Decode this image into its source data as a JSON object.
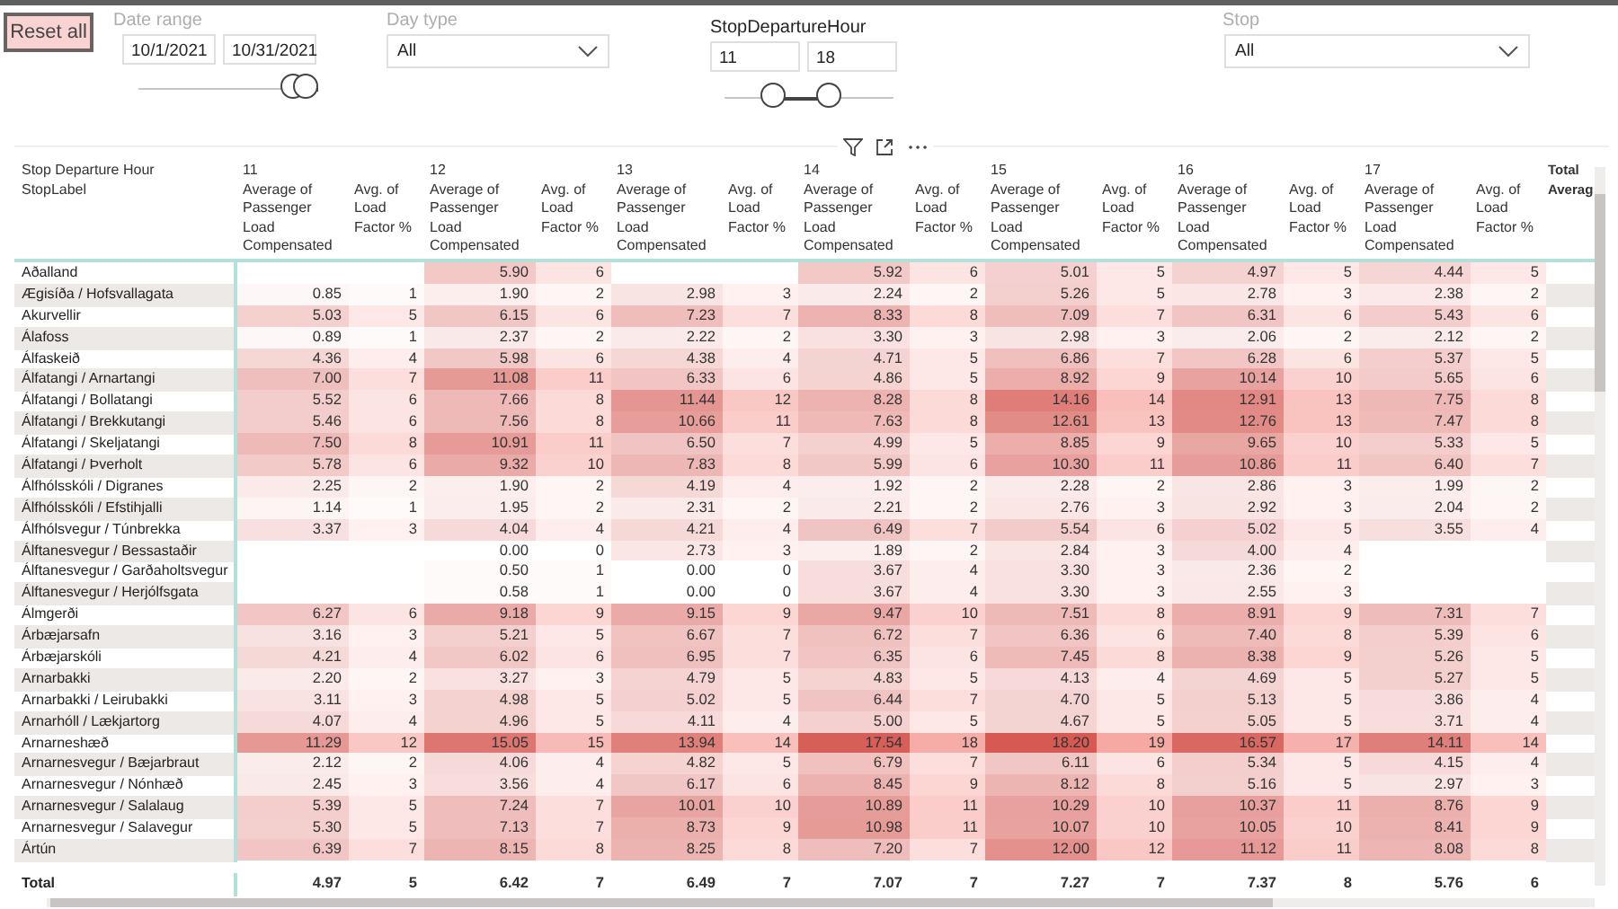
{
  "filters": {
    "reset_button": "Reset all",
    "date_range": {
      "label": "Date range",
      "start": "10/1/2021",
      "end": "10/31/2021",
      "slider": {
        "handles": [
          {
            "level": 0.93
          },
          {
            "level": 1.0
          }
        ]
      }
    },
    "day_type": {
      "label": "Day type",
      "value": "All"
    },
    "departure_hour": {
      "label": "StopDepartureHour",
      "start": "11",
      "end": "18",
      "slider": {
        "handles": [
          {
            "level": 0.29
          },
          {
            "level": 0.62
          }
        ]
      }
    },
    "stop": {
      "label": "Stop",
      "value": "All"
    }
  },
  "table": {
    "corner_top": "Stop Departure Hour",
    "corner_bottom": "StopLabel",
    "hours": [
      {
        "hour": "11",
        "measure_1": "Average of Passenger Load Compensated",
        "measure_2": "Avg. of Load Factor %"
      },
      {
        "hour": "12",
        "measure_1": "Average of Passenger Load Compensated",
        "measure_2": "Avg. of Load Factor %"
      },
      {
        "hour": "13",
        "measure_1": "Average of Passenger Load Compensated",
        "measure_2": "Avg. of Load Factor %"
      },
      {
        "hour": "14",
        "measure_1": "Average of Passenger Load Compensated",
        "measure_2": "Avg. of Load Factor %"
      },
      {
        "hour": "15",
        "measure_1": "Average of Passenger Load Compensated",
        "measure_2": "Avg. of Load Factor %"
      },
      {
        "hour": "16",
        "measure_1": "Average of Passenger Load Compensated",
        "measure_2": "Avg. of Load Factor %"
      },
      {
        "hour": "17",
        "measure_1": "Average of Passenger Load Compensated",
        "measure_2": "Avg. of Load Factor %"
      }
    ],
    "total_header": "Total Averag",
    "rows": [
      {
        "label": "Aðalland",
        "cells": [
          null,
          [
            "5.90",
            "6"
          ],
          null,
          [
            "5.92",
            "6"
          ],
          [
            "5.01",
            "5"
          ],
          [
            "4.97",
            "5"
          ],
          [
            "4.44",
            "5"
          ]
        ]
      },
      {
        "label": "Ægisíða / Hofsvallagata",
        "cells": [
          [
            "0.85",
            "1"
          ],
          [
            "1.90",
            "2"
          ],
          [
            "2.98",
            "3"
          ],
          [
            "2.24",
            "2"
          ],
          [
            "5.26",
            "5"
          ],
          [
            "2.78",
            "3"
          ],
          [
            "2.38",
            "2"
          ]
        ]
      },
      {
        "label": "Akurvellir",
        "cells": [
          [
            "5.03",
            "5"
          ],
          [
            "6.15",
            "6"
          ],
          [
            "7.23",
            "7"
          ],
          [
            "8.33",
            "8"
          ],
          [
            "7.09",
            "7"
          ],
          [
            "6.31",
            "6"
          ],
          [
            "5.43",
            "6"
          ]
        ]
      },
      {
        "label": "Álafoss",
        "cells": [
          [
            "0.89",
            "1"
          ],
          [
            "2.37",
            "2"
          ],
          [
            "2.22",
            "2"
          ],
          [
            "3.30",
            "3"
          ],
          [
            "2.98",
            "3"
          ],
          [
            "2.06",
            "2"
          ],
          [
            "2.12",
            "2"
          ]
        ]
      },
      {
        "label": "Álfaskeið",
        "cells": [
          [
            "4.36",
            "4"
          ],
          [
            "5.98",
            "6"
          ],
          [
            "4.38",
            "4"
          ],
          [
            "4.71",
            "5"
          ],
          [
            "6.86",
            "7"
          ],
          [
            "6.28",
            "6"
          ],
          [
            "5.37",
            "5"
          ]
        ]
      },
      {
        "label": "Álfatangi / Arnartangi",
        "cells": [
          [
            "7.00",
            "7"
          ],
          [
            "11.08",
            "11"
          ],
          [
            "6.33",
            "6"
          ],
          [
            "4.86",
            "5"
          ],
          [
            "8.92",
            "9"
          ],
          [
            "10.14",
            "10"
          ],
          [
            "5.65",
            "6"
          ]
        ]
      },
      {
        "label": "Álfatangi / Bollatangi",
        "cells": [
          [
            "5.52",
            "6"
          ],
          [
            "7.66",
            "8"
          ],
          [
            "11.44",
            "12"
          ],
          [
            "8.28",
            "8"
          ],
          [
            "14.16",
            "14"
          ],
          [
            "12.91",
            "13"
          ],
          [
            "7.75",
            "8"
          ]
        ]
      },
      {
        "label": "Álfatangi / Brekkutangi",
        "cells": [
          [
            "5.46",
            "6"
          ],
          [
            "7.56",
            "8"
          ],
          [
            "10.66",
            "11"
          ],
          [
            "7.63",
            "8"
          ],
          [
            "12.61",
            "13"
          ],
          [
            "12.76",
            "13"
          ],
          [
            "7.47",
            "8"
          ]
        ]
      },
      {
        "label": "Álfatangi / Skeljatangi",
        "cells": [
          [
            "7.50",
            "8"
          ],
          [
            "10.91",
            "11"
          ],
          [
            "6.50",
            "7"
          ],
          [
            "4.99",
            "5"
          ],
          [
            "8.85",
            "9"
          ],
          [
            "9.65",
            "10"
          ],
          [
            "5.33",
            "5"
          ]
        ]
      },
      {
        "label": "Álfatangi / Þverholt",
        "cells": [
          [
            "5.78",
            "6"
          ],
          [
            "9.32",
            "10"
          ],
          [
            "7.83",
            "8"
          ],
          [
            "5.99",
            "6"
          ],
          [
            "10.30",
            "11"
          ],
          [
            "10.86",
            "11"
          ],
          [
            "6.40",
            "7"
          ]
        ]
      },
      {
        "label": "Álfhólsskóli / Digranes",
        "cells": [
          [
            "2.25",
            "2"
          ],
          [
            "1.90",
            "2"
          ],
          [
            "4.19",
            "4"
          ],
          [
            "1.92",
            "2"
          ],
          [
            "2.28",
            "2"
          ],
          [
            "2.86",
            "3"
          ],
          [
            "1.99",
            "2"
          ]
        ]
      },
      {
        "label": "Álfhólsskóli / Efstihjalli",
        "cells": [
          [
            "1.14",
            "1"
          ],
          [
            "1.95",
            "2"
          ],
          [
            "2.31",
            "2"
          ],
          [
            "2.21",
            "2"
          ],
          [
            "2.76",
            "3"
          ],
          [
            "2.92",
            "3"
          ],
          [
            "2.04",
            "2"
          ]
        ]
      },
      {
        "label": "Álfhólsvegur / Túnbrekka",
        "cells": [
          [
            "3.37",
            "3"
          ],
          [
            "4.04",
            "4"
          ],
          [
            "4.21",
            "4"
          ],
          [
            "6.49",
            "7"
          ],
          [
            "5.54",
            "6"
          ],
          [
            "5.02",
            "5"
          ],
          [
            "3.55",
            "4"
          ]
        ]
      },
      {
        "label": "Álftanesvegur / Bessastaðir",
        "cells": [
          null,
          [
            "0.00",
            "0"
          ],
          [
            "2.73",
            "3"
          ],
          [
            "1.89",
            "2"
          ],
          [
            "2.84",
            "3"
          ],
          [
            "4.00",
            "4"
          ],
          null
        ]
      },
      {
        "label": "Álftanesvegur / Garðaholtsvegur",
        "cells": [
          null,
          [
            "0.50",
            "1"
          ],
          [
            "0.00",
            "0"
          ],
          [
            "3.67",
            "4"
          ],
          [
            "3.30",
            "3"
          ],
          [
            "2.36",
            "2"
          ],
          null
        ]
      },
      {
        "label": "Álftanesvegur / Herjólfsgata",
        "cells": [
          null,
          [
            "0.58",
            "1"
          ],
          [
            "0.00",
            "0"
          ],
          [
            "3.67",
            "4"
          ],
          [
            "3.30",
            "3"
          ],
          [
            "2.55",
            "3"
          ],
          null
        ]
      },
      {
        "label": "Álmgerði",
        "cells": [
          [
            "6.27",
            "6"
          ],
          [
            "9.18",
            "9"
          ],
          [
            "9.15",
            "9"
          ],
          [
            "9.47",
            "10"
          ],
          [
            "7.51",
            "8"
          ],
          [
            "8.91",
            "9"
          ],
          [
            "7.31",
            "7"
          ]
        ]
      },
      {
        "label": "Árbæjarsafn",
        "cells": [
          [
            "3.16",
            "3"
          ],
          [
            "5.21",
            "5"
          ],
          [
            "6.67",
            "7"
          ],
          [
            "6.72",
            "7"
          ],
          [
            "6.36",
            "6"
          ],
          [
            "7.40",
            "8"
          ],
          [
            "5.39",
            "6"
          ]
        ]
      },
      {
        "label": "Árbæjarskóli",
        "cells": [
          [
            "4.21",
            "4"
          ],
          [
            "6.02",
            "6"
          ],
          [
            "6.95",
            "7"
          ],
          [
            "6.35",
            "6"
          ],
          [
            "7.45",
            "8"
          ],
          [
            "8.38",
            "9"
          ],
          [
            "5.26",
            "5"
          ]
        ]
      },
      {
        "label": "Arnarbakki",
        "cells": [
          [
            "2.20",
            "2"
          ],
          [
            "3.27",
            "3"
          ],
          [
            "4.79",
            "5"
          ],
          [
            "4.83",
            "5"
          ],
          [
            "4.13",
            "4"
          ],
          [
            "4.69",
            "5"
          ],
          [
            "5.27",
            "5"
          ]
        ]
      },
      {
        "label": "Arnarbakki / Leirubakki",
        "cells": [
          [
            "3.11",
            "3"
          ],
          [
            "4.98",
            "5"
          ],
          [
            "5.02",
            "5"
          ],
          [
            "6.44",
            "7"
          ],
          [
            "4.70",
            "5"
          ],
          [
            "5.13",
            "5"
          ],
          [
            "3.86",
            "4"
          ]
        ]
      },
      {
        "label": "Arnarhóll / Lækjartorg",
        "cells": [
          [
            "4.07",
            "4"
          ],
          [
            "4.96",
            "5"
          ],
          [
            "4.11",
            "4"
          ],
          [
            "5.00",
            "5"
          ],
          [
            "4.67",
            "5"
          ],
          [
            "5.05",
            "5"
          ],
          [
            "3.71",
            "4"
          ]
        ]
      },
      {
        "label": "Arnarneshæð",
        "cells": [
          [
            "11.29",
            "12"
          ],
          [
            "15.05",
            "15"
          ],
          [
            "13.94",
            "14"
          ],
          [
            "17.54",
            "18"
          ],
          [
            "18.20",
            "19"
          ],
          [
            "16.57",
            "17"
          ],
          [
            "14.11",
            "14"
          ]
        ]
      },
      {
        "label": "Arnarnesvegur / Bæjarbraut",
        "cells": [
          [
            "2.12",
            "2"
          ],
          [
            "4.06",
            "4"
          ],
          [
            "4.82",
            "5"
          ],
          [
            "6.79",
            "7"
          ],
          [
            "6.11",
            "6"
          ],
          [
            "5.34",
            "5"
          ],
          [
            "4.15",
            "4"
          ]
        ]
      },
      {
        "label": "Arnarnesvegur / Nónhæð",
        "cells": [
          [
            "2.45",
            "3"
          ],
          [
            "3.56",
            "4"
          ],
          [
            "6.17",
            "6"
          ],
          [
            "8.45",
            "9"
          ],
          [
            "8.12",
            "8"
          ],
          [
            "5.16",
            "5"
          ],
          [
            "2.97",
            "3"
          ]
        ]
      },
      {
        "label": "Arnarnesvegur / Salalaug",
        "cells": [
          [
            "5.39",
            "5"
          ],
          [
            "7.24",
            "7"
          ],
          [
            "10.01",
            "10"
          ],
          [
            "10.89",
            "11"
          ],
          [
            "10.29",
            "10"
          ],
          [
            "10.37",
            "11"
          ],
          [
            "8.76",
            "9"
          ]
        ]
      },
      {
        "label": "Arnarnesvegur / Salavegur",
        "cells": [
          [
            "5.30",
            "5"
          ],
          [
            "7.13",
            "7"
          ],
          [
            "8.73",
            "9"
          ],
          [
            "10.98",
            "11"
          ],
          [
            "10.07",
            "10"
          ],
          [
            "10.05",
            "10"
          ],
          [
            "8.41",
            "9"
          ]
        ]
      },
      {
        "label": "Ártún",
        "cells": [
          [
            "6.39",
            "7"
          ],
          [
            "8.15",
            "8"
          ],
          [
            "8.25",
            "8"
          ],
          [
            "7.20",
            "7"
          ],
          [
            "12.00",
            "12"
          ],
          [
            "11.12",
            "11"
          ],
          [
            "8.08",
            "8"
          ]
        ]
      }
    ],
    "total": {
      "label": "Total",
      "cells": [
        [
          "4.97",
          "5"
        ],
        [
          "6.42",
          "7"
        ],
        [
          "6.49",
          "7"
        ],
        [
          "7.07",
          "7"
        ],
        [
          "7.27",
          "7"
        ],
        [
          "7.37",
          "8"
        ],
        [
          "5.76",
          "6"
        ]
      ]
    }
  }
}
